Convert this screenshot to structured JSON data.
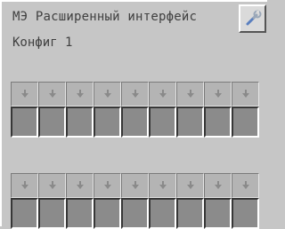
{
  "window": {
    "title": "МЭ Расширенный интерфейс",
    "config_label": "Конфиг 1"
  },
  "toolbar": {
    "wrench_icon": "wrench-icon"
  },
  "grid_rows": 2,
  "grid_columns": 9,
  "colors": {
    "background": "#c6c6c6",
    "slot": "#8b8b8b",
    "text": "#404040",
    "button": "#dadada"
  }
}
